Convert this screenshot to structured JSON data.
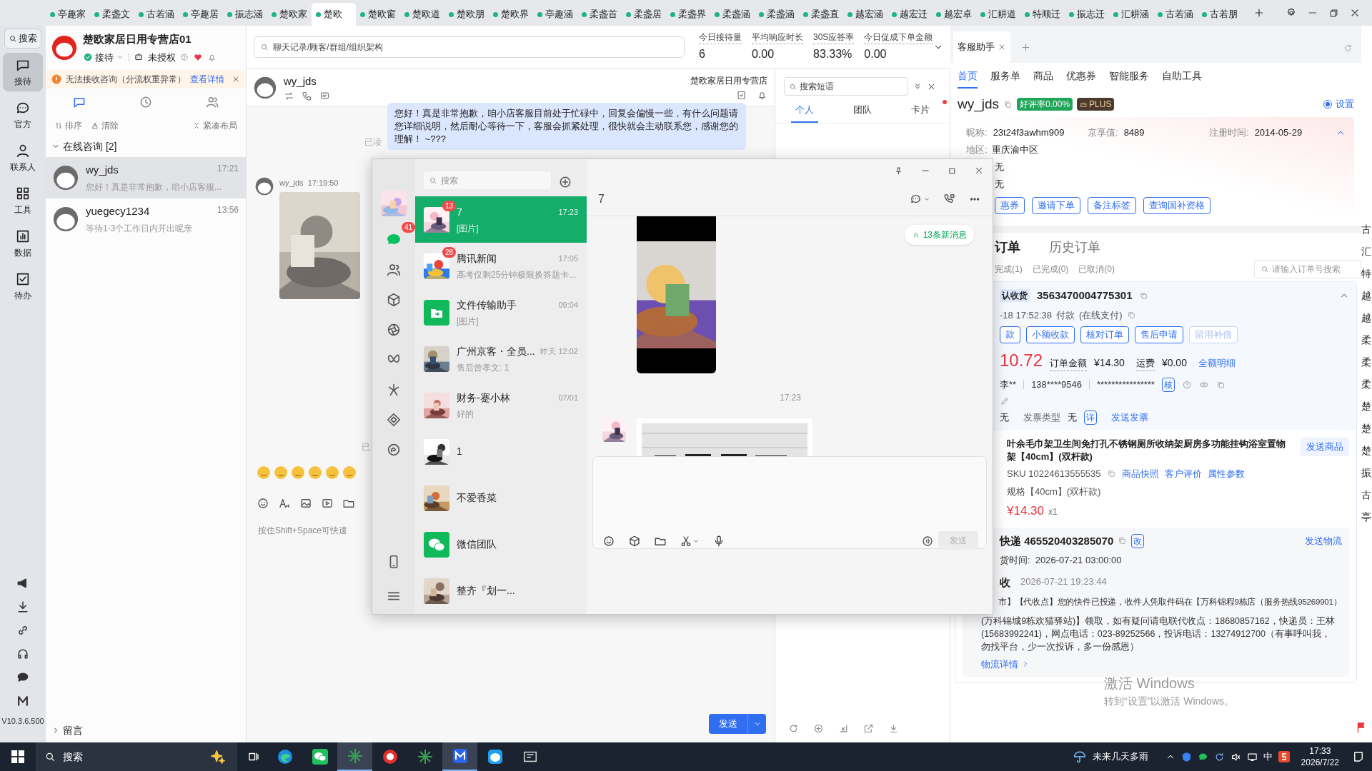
{
  "top_tabs": [
    {
      "label": "亭趣家",
      "selected": false
    },
    {
      "label": "柔盏文",
      "selected": false
    },
    {
      "label": "古若涵",
      "selected": false
    },
    {
      "label": "亭趣居",
      "selected": false
    },
    {
      "label": "振志涵",
      "selected": false
    },
    {
      "label": "楚欧家",
      "selected": false
    },
    {
      "label": "楚欧",
      "selected": true
    },
    {
      "label": "楚欧窗",
      "selected": false
    },
    {
      "label": "楚欧道",
      "selected": false
    },
    {
      "label": "楚欧朋",
      "selected": false
    },
    {
      "label": "楚欧界",
      "selected": false
    },
    {
      "label": "亭趣涵",
      "selected": false
    },
    {
      "label": "柔盏首",
      "selected": false
    },
    {
      "label": "柔盏居",
      "selected": false
    },
    {
      "label": "柔盏界",
      "selected": false
    },
    {
      "label": "柔盏涵",
      "selected": false
    },
    {
      "label": "柔盏涵",
      "selected": false
    },
    {
      "label": "柔盏直",
      "selected": false
    },
    {
      "label": "越宏涵",
      "selected": false
    },
    {
      "label": "越宏迁",
      "selected": false
    },
    {
      "label": "越宏卓",
      "selected": false
    },
    {
      "label": "汇耕道",
      "selected": false
    },
    {
      "label": "特顺迁",
      "selected": false
    },
    {
      "label": "振志迁",
      "selected": false
    },
    {
      "label": "汇耕涵",
      "selected": false
    },
    {
      "label": "古若涵",
      "selected": false
    },
    {
      "label": "古若朋",
      "selected": false
    }
  ],
  "nav_rail": {
    "search": "搜索",
    "items": [
      {
        "label": "接待",
        "selected": true
      },
      {
        "label": "官方",
        "selected": false
      },
      {
        "label": "联系人",
        "selected": false
      },
      {
        "label": "工具",
        "selected": false
      },
      {
        "label": "数据",
        "selected": false
      },
      {
        "label": "待办",
        "selected": false
      }
    ],
    "version": "V10.3.6.500"
  },
  "shop": {
    "name": "楚欧家居日用专营店01",
    "status": "接待",
    "auth": "未授权"
  },
  "alert": {
    "text": "无法接收咨询（分流权重异常）",
    "link": "查看详情"
  },
  "list_tabs": [
    {
      "selected": true
    },
    {
      "selected": false
    },
    {
      "selected": false
    }
  ],
  "list_actions": [
    "排序",
    "清除",
    "紧凑布局"
  ],
  "group": {
    "label": "在线咨询 [2]",
    "expanded": true
  },
  "sessions": [
    {
      "name": "wy_jds",
      "time": "17:21",
      "preview": "您好！真是非常抱歉，咱小店客服...",
      "selected": true
    },
    {
      "name": "yuegecy1234",
      "time": "13:56",
      "preview": "等待1-3个工作日内开出呢亲",
      "selected": false
    }
  ],
  "footer_group": {
    "label": "留言",
    "expanded": false
  },
  "search": {
    "placeholder": "聊天记录/顾客/群组/组织架构"
  },
  "stats": [
    {
      "label": "今日接待量",
      "value": "6"
    },
    {
      "label": "平均响应时长",
      "value": "0.00"
    },
    {
      "label": "30S应答率",
      "value": "83.33%"
    },
    {
      "label": "今日促成下单金额",
      "value": "0.00"
    }
  ],
  "chat": {
    "customer": "wy_jds",
    "shop": "楚欧家居日用专营店",
    "outgoing": "您好！真是非常抱歉，咱小店客服目前处于忙碌中，回复会偏慢一些，有什么问题请您详细说明，然后耐心等待一下，客服会抓紧处理，很快就会主动联系您，感谢您的理解！ ~???",
    "read": "已读",
    "sender": "wy_jds",
    "sent_at": "17:19:50",
    "read_second": "已",
    "placeholder": "按住Shift+Space可快速",
    "send": "发送"
  },
  "phrases": {
    "placeholder": "搜索短语",
    "tabs": [
      {
        "label": "个人",
        "selected": true,
        "dot": false
      },
      {
        "label": "团队",
        "selected": false,
        "dot": false
      },
      {
        "label": "卡片",
        "selected": false,
        "dot": true
      }
    ]
  },
  "wechat": {
    "nav_badge": "41",
    "search_placeholder": "搜索",
    "chats": [
      {
        "name": "7",
        "time": "17:23",
        "preview": "[图片]",
        "badge": "13",
        "selected": true
      },
      {
        "name": "腾讯新闻",
        "time": "17:05",
        "preview": "高考仅剩25分钟极限换答题卡...",
        "badge": "28",
        "selected": false
      },
      {
        "name": "文件传输助手",
        "time": "09:04",
        "preview": "[图片]",
        "selected": false
      },
      {
        "name": "广州京客・全员...",
        "time": "昨天 12:02",
        "preview": "售后曾孝文: 1",
        "selected": false
      },
      {
        "name": "财务-蹇小林",
        "time": "07/01",
        "preview": "好的",
        "selected": false
      },
      {
        "name": "1",
        "selected": false
      },
      {
        "name": "不爱香菜",
        "selected": false
      },
      {
        "name": "微信团队",
        "selected": false
      },
      {
        "name": "整齐『划一...",
        "selected": false
      }
    ],
    "conversation": {
      "title": "7",
      "new_messages": "13条新消息",
      "time": "17:23",
      "send": "发送"
    }
  },
  "assistant": {
    "tab": "客服助手",
    "nav": [
      {
        "label": "首页",
        "selected": true
      },
      {
        "label": "服务单",
        "selected": false
      },
      {
        "label": "商品",
        "selected": false
      },
      {
        "label": "优惠券",
        "selected": false
      },
      {
        "label": "智能服务",
        "selected": false
      },
      {
        "label": "自助工具",
        "selected": false
      }
    ],
    "customer": {
      "name": "wy_jds",
      "rating": "好评率0.00%",
      "tier": "PLUS",
      "settings": "设置",
      "settings_on": true
    },
    "profile": [
      {
        "label": "昵称:",
        "value": "23t24f3awhm909"
      },
      {
        "label": "京享值:",
        "value": "8489"
      },
      {
        "label": "注册时间:",
        "value": "2014-05-29"
      }
    ],
    "region": {
      "label": "地区:",
      "value": "重庆渝中区"
    },
    "extra_values": [
      "无",
      "无"
    ],
    "actions": [
      "惠券",
      "邀请下单",
      "备注标签",
      "查询国补资格"
    ],
    "order_tabs": [
      {
        "label": "订单",
        "selected": true
      },
      {
        "label": "历史订单",
        "selected": false
      }
    ],
    "order_filters": [
      "完成(1)",
      "已完成(0)",
      "已取消(0)"
    ],
    "order_search": {
      "placeholder": "请输入订单号搜索"
    },
    "order": {
      "status": "认收货",
      "id": "3563470004775301",
      "paid": "-18 17:52:38",
      "pay_label": "付款",
      "pay_method": "(在线支付)",
      "actions": [
        {
          "label": "款",
          "disabled": false
        },
        {
          "label": "小额收款",
          "disabled": false
        },
        {
          "label": "核对订单",
          "disabled": false
        },
        {
          "label": "售后申请",
          "disabled": false
        },
        {
          "label": "留用补偿",
          "disabled": true
        }
      ],
      "amount": "10.72",
      "total_label": "订单金额",
      "total": "¥14.30",
      "shipping_label": "运费",
      "shipping": "¥0.00",
      "detail_link": "全额明细",
      "buyer": "李**",
      "phone": "138****9546",
      "address": "****************",
      "verify": "核",
      "invoice": {
        "value": "无",
        "type_label": "发票类型",
        "type": "无",
        "detail": "详",
        "send": "发送发票"
      },
      "product": {
        "title": "叶余毛巾架卫生间免打孔不锈钢厕所收纳架厨房多功能挂钩浴室置物架【40cm】(双杆款)",
        "send": "发送商品",
        "sku": "SKU 10224613555535",
        "links": [
          "商品快照",
          "客户评价",
          "属性参数"
        ],
        "spec": "规格【40cm】(双杆款)",
        "price": "¥14.30",
        "qty": "x1"
      },
      "shipment": {
        "carrier": "快递 465520403285070",
        "edit": "改",
        "send": "发送物流",
        "ship_time": "货时间:  2026-07-21 03:00:00",
        "event_label": "收",
        "event_time": "2026-07-21 19:23:44",
        "detail_first": "市】【代收点】您的快件已投递，收件人凭取件码在【万科锦程9栋店（服务热线95269901）",
        "detail_rest": "(万科锦城9栋欢猫驿站)】领取，如有疑问请电联代收点：18680857162，快递员：王林(15683992241)，网点电话：023-89252566，投诉电话：13274912700（有事呼叫我，勿找平台，少一次投诉，多一份感恩）",
        "more": "物流详情"
      }
    }
  },
  "edge_labels": [
    "古",
    "汇",
    "特",
    "越",
    "越",
    "柔",
    "柔",
    "柔",
    "楚",
    "楚",
    "楚",
    "振",
    "古",
    "亭"
  ],
  "activation": {
    "title": "激活 Windows",
    "hint": "转到“设置”以激活 Windows。"
  },
  "taskbar": {
    "search": "搜索",
    "apps": [
      {
        "active": false
      },
      {
        "active": false
      },
      {
        "active": true
      },
      {
        "active": false
      },
      {
        "active": false
      },
      {
        "active": true
      },
      {
        "active": false
      },
      {
        "active": false
      }
    ],
    "weather": "未来几天多雨",
    "ime": "中",
    "time": "17:33",
    "date": "2026/7/22"
  }
}
